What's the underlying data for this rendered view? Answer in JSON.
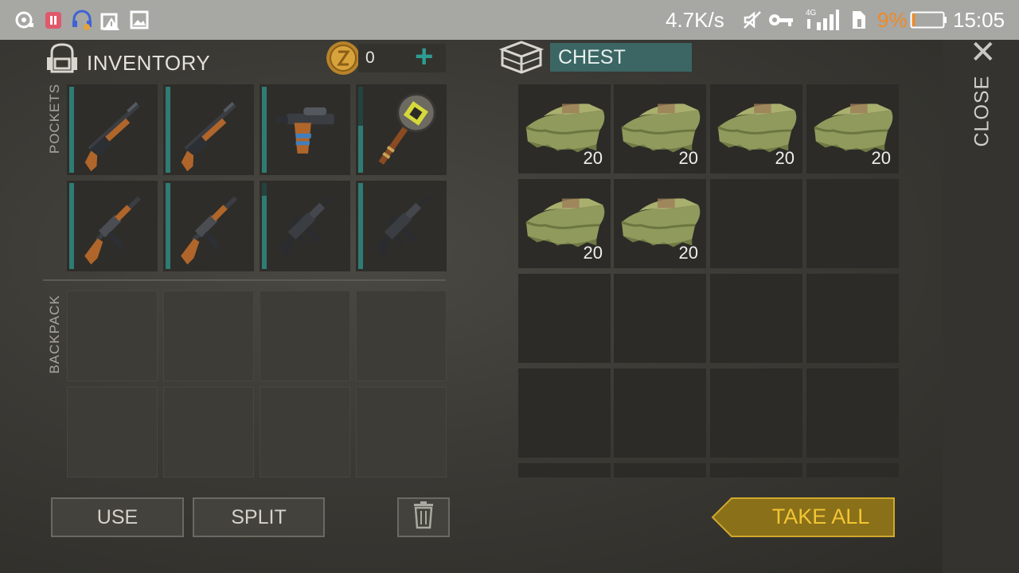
{
  "status_bar": {
    "net_speed": "4.7K/s",
    "network_type": "4G",
    "battery_percent": "9%",
    "time": "15:05",
    "icons": [
      "media-icon",
      "battery-saver-icon",
      "headset-icon",
      "alert-icon",
      "gallery-icon",
      "mute-icon",
      "vpn-key-icon",
      "signal-icon",
      "data-saver-icon",
      "battery-icon"
    ],
    "battery_level": 0.09,
    "battery_color": "#f08a24"
  },
  "inventory": {
    "title": "INVENTORY",
    "coins": "0",
    "add_symbol": "+",
    "pockets_label": "POCKETS",
    "backpack_label": "BACKPACK",
    "pockets": [
      {
        "item": "shotgun",
        "durability": 1.0
      },
      {
        "item": "shotgun",
        "durability": 1.0
      },
      {
        "item": "pistol",
        "durability": 1.0
      },
      {
        "item": "mace",
        "durability": 0.55
      },
      {
        "item": "ak-rifle",
        "durability": 1.0
      },
      {
        "item": "ak-rifle",
        "durability": 1.0
      },
      {
        "item": "m4-rifle",
        "durability": 0.85
      },
      {
        "item": "m4-rifle",
        "durability": 1.0
      }
    ],
    "backpack_slots": 8
  },
  "chest": {
    "title": "CHEST",
    "items": [
      {
        "item": "cloth",
        "quantity": "20"
      },
      {
        "item": "cloth",
        "quantity": "20"
      },
      {
        "item": "cloth",
        "quantity": "20"
      },
      {
        "item": "cloth",
        "quantity": "20"
      },
      {
        "item": "cloth",
        "quantity": "20"
      },
      {
        "item": "cloth",
        "quantity": "20"
      }
    ],
    "total_slots": 16
  },
  "buttons": {
    "use": "USE",
    "split": "SPLIT",
    "take_all": "TAKE ALL",
    "close": "CLOSE",
    "close_symbol": "✕"
  },
  "colors": {
    "accent_teal": "#2f7c74",
    "take_all_gold": "#8a7019",
    "take_all_text": "#f2c533"
  }
}
